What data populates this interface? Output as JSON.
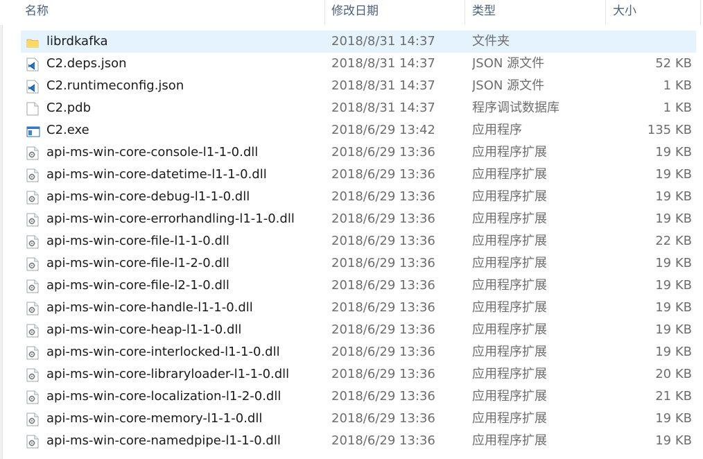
{
  "header": {
    "name_label": "名称",
    "date_label": "修改日期",
    "type_label": "类型",
    "size_label": "大小",
    "sort_arrow": "^"
  },
  "files": [
    {
      "name": "librdkafka",
      "date": "2018/8/31 14:37",
      "type": "文件夹",
      "size": "",
      "icon": "folder-icon",
      "selected": true
    },
    {
      "name": "C2.deps.json",
      "date": "2018/8/31 14:37",
      "type": "JSON 源文件",
      "size": "52 KB",
      "icon": "vscode-json-icon"
    },
    {
      "name": "C2.runtimeconfig.json",
      "date": "2018/8/31 14:37",
      "type": "JSON 源文件",
      "size": "1 KB",
      "icon": "vscode-json-icon"
    },
    {
      "name": "C2.pdb",
      "date": "2018/8/31 14:37",
      "type": "程序调试数据库",
      "size": "1 KB",
      "icon": "blank-file-icon"
    },
    {
      "name": "C2.exe",
      "date": "2018/6/29 13:42",
      "type": "应用程序",
      "size": "135 KB",
      "icon": "exe-window-icon"
    },
    {
      "name": "api-ms-win-core-console-l1-1-0.dll",
      "date": "2018/6/29 13:36",
      "type": "应用程序扩展",
      "size": "19 KB",
      "icon": "dll-gear-icon"
    },
    {
      "name": "api-ms-win-core-datetime-l1-1-0.dll",
      "date": "2018/6/29 13:36",
      "type": "应用程序扩展",
      "size": "19 KB",
      "icon": "dll-gear-icon"
    },
    {
      "name": "api-ms-win-core-debug-l1-1-0.dll",
      "date": "2018/6/29 13:36",
      "type": "应用程序扩展",
      "size": "19 KB",
      "icon": "dll-gear-icon"
    },
    {
      "name": "api-ms-win-core-errorhandling-l1-1-0.dll",
      "date": "2018/6/29 13:36",
      "type": "应用程序扩展",
      "size": "19 KB",
      "icon": "dll-gear-icon"
    },
    {
      "name": "api-ms-win-core-file-l1-1-0.dll",
      "date": "2018/6/29 13:36",
      "type": "应用程序扩展",
      "size": "22 KB",
      "icon": "dll-gear-icon"
    },
    {
      "name": "api-ms-win-core-file-l1-2-0.dll",
      "date": "2018/6/29 13:36",
      "type": "应用程序扩展",
      "size": "19 KB",
      "icon": "dll-gear-icon"
    },
    {
      "name": "api-ms-win-core-file-l2-1-0.dll",
      "date": "2018/6/29 13:36",
      "type": "应用程序扩展",
      "size": "19 KB",
      "icon": "dll-gear-icon"
    },
    {
      "name": "api-ms-win-core-handle-l1-1-0.dll",
      "date": "2018/6/29 13:36",
      "type": "应用程序扩展",
      "size": "19 KB",
      "icon": "dll-gear-icon"
    },
    {
      "name": "api-ms-win-core-heap-l1-1-0.dll",
      "date": "2018/6/29 13:36",
      "type": "应用程序扩展",
      "size": "19 KB",
      "icon": "dll-gear-icon"
    },
    {
      "name": "api-ms-win-core-interlocked-l1-1-0.dll",
      "date": "2018/6/29 13:36",
      "type": "应用程序扩展",
      "size": "19 KB",
      "icon": "dll-gear-icon"
    },
    {
      "name": "api-ms-win-core-libraryloader-l1-1-0.dll",
      "date": "2018/6/29 13:36",
      "type": "应用程序扩展",
      "size": "20 KB",
      "icon": "dll-gear-icon"
    },
    {
      "name": "api-ms-win-core-localization-l1-2-0.dll",
      "date": "2018/6/29 13:36",
      "type": "应用程序扩展",
      "size": "21 KB",
      "icon": "dll-gear-icon"
    },
    {
      "name": "api-ms-win-core-memory-l1-1-0.dll",
      "date": "2018/6/29 13:36",
      "type": "应用程序扩展",
      "size": "19 KB",
      "icon": "dll-gear-icon"
    },
    {
      "name": "api-ms-win-core-namedpipe-l1-1-0.dll",
      "date": "2018/6/29 13:36",
      "type": "应用程序扩展",
      "size": "19 KB",
      "icon": "dll-gear-icon"
    }
  ],
  "colors": {
    "header_text": "#4c607a",
    "name_text": "#1a1a1a",
    "meta_text": "#6d6d6d",
    "selected_bg": "#e5f3ff",
    "folder": "#f8d775",
    "vscode_blue": "#1e7bd3"
  }
}
